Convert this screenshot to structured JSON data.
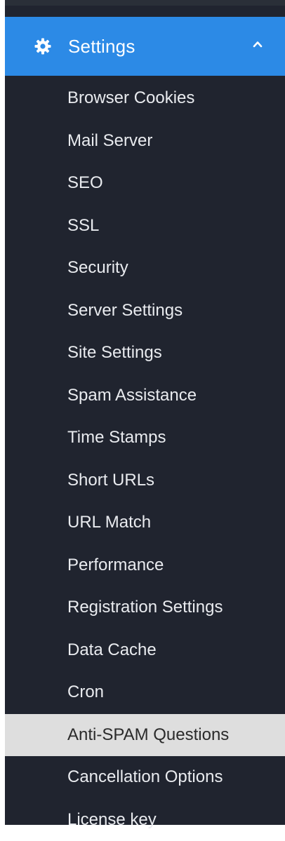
{
  "sidebar": {
    "section": {
      "label": "Settings",
      "icon": "gear-icon",
      "state_icon": "chevron-up-icon"
    },
    "colors": {
      "sidebar_bg": "#20242f",
      "header_bg": "#2c8ae6",
      "item_text": "#e9ebef",
      "active_bg": "#dedede",
      "active_text": "#2b2b2b"
    },
    "items": [
      {
        "label": "Browser Cookies"
      },
      {
        "label": "Mail Server"
      },
      {
        "label": "SEO"
      },
      {
        "label": "SSL"
      },
      {
        "label": "Security"
      },
      {
        "label": "Server Settings"
      },
      {
        "label": "Site Settings"
      },
      {
        "label": "Spam Assistance"
      },
      {
        "label": "Time Stamps"
      },
      {
        "label": "Short URLs"
      },
      {
        "label": "URL Match"
      },
      {
        "label": "Performance"
      },
      {
        "label": "Registration Settings"
      },
      {
        "label": "Data Cache"
      },
      {
        "label": "Cron"
      },
      {
        "label": "Anti-SPAM Questions",
        "active": true
      },
      {
        "label": "Cancellation Options"
      },
      {
        "label": "License key"
      }
    ]
  }
}
